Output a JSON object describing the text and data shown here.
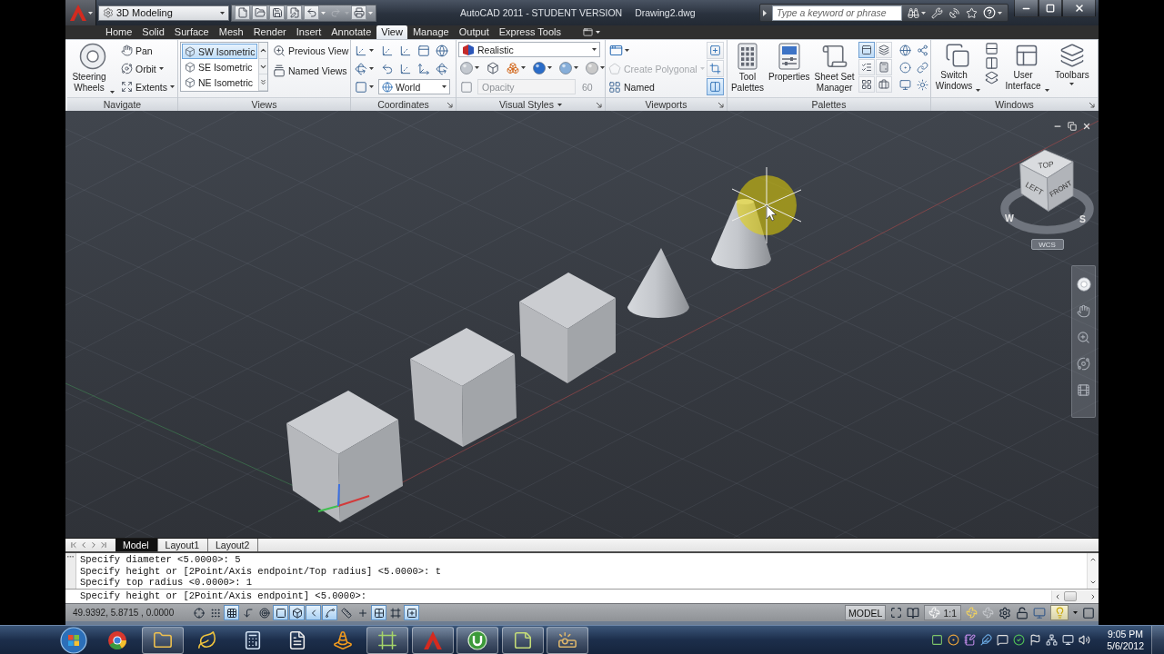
{
  "title_bar": {
    "workspace": "3D Modeling",
    "quick_access": [
      {
        "disabled": false
      },
      {
        "disabled": false
      },
      {
        "disabled": false
      },
      {
        "disabled": false
      },
      {
        "disabled": false
      },
      {
        "disabled": true
      },
      {
        "disabled": false
      }
    ],
    "app_title": "AutoCAD 2011 - STUDENT VERSION",
    "file_name": "Drawing2.dwg",
    "search": {
      "placeholder": "Type a keyword or phrase"
    }
  },
  "tabs": [
    {
      "label": "Home",
      "selected": false
    },
    {
      "label": "Solid",
      "selected": false
    },
    {
      "label": "Surface",
      "selected": false
    },
    {
      "label": "Mesh",
      "selected": false
    },
    {
      "label": "Render",
      "selected": false
    },
    {
      "label": "Insert",
      "selected": false
    },
    {
      "label": "Annotate",
      "selected": false
    },
    {
      "label": "View",
      "selected": true
    },
    {
      "label": "Manage",
      "selected": false
    },
    {
      "label": "Output",
      "selected": false
    },
    {
      "label": "Express Tools",
      "selected": false
    }
  ],
  "ribbon": {
    "navigate": {
      "title": "Navigate",
      "steering_wheels": "Steering Wheels",
      "tools": [
        "Pan",
        "Orbit",
        "Extents"
      ]
    },
    "views": {
      "title": "Views",
      "list": [
        {
          "label": "SW Isometric",
          "selected": true
        },
        {
          "label": "SE Isometric",
          "selected": false
        },
        {
          "label": "NE Isometric",
          "selected": false
        }
      ],
      "tools": [
        "Previous View",
        "Named Views"
      ]
    },
    "coordinates": {
      "title": "Coordinates",
      "ucs": "World"
    },
    "visual_styles": {
      "title": "Visual Styles",
      "style": "Realistic",
      "opacity": {
        "label": "Opacity",
        "value": "60",
        "disabled": true
      }
    },
    "viewports": {
      "title": "Viewports",
      "tools": [
        {
          "label": "Create Polygonal",
          "disabled": true
        },
        {
          "label": "Named",
          "disabled": false
        }
      ],
      "toggles": [
        {
          "on": false
        },
        {
          "on": false
        },
        {
          "on": true
        }
      ]
    },
    "palettes": {
      "title": "Palettes",
      "buttons": [
        "Tool Palettes",
        "Properties",
        "Sheet Set Manager"
      ],
      "toggles": [
        {
          "on": true
        },
        {
          "on": false
        },
        {
          "on": false
        },
        {
          "on": false
        },
        {
          "on": false
        },
        {
          "on": false
        }
      ]
    },
    "windows": {
      "title": "Windows",
      "buttons": [
        "Switch Windows",
        "User Interface",
        "Toolbars"
      ]
    }
  },
  "viewcube": {
    "faces": [
      "TOP",
      "LEFT",
      "FRONT"
    ],
    "compass": [
      "W",
      "S"
    ],
    "ucs_menu": "WCS"
  },
  "layout_tabs": [
    {
      "label": "Model",
      "selected": true
    },
    {
      "label": "Layout1",
      "selected": false
    },
    {
      "label": "Layout2",
      "selected": false
    }
  ],
  "command_line": {
    "history": [
      "Specify diameter <5.0000>: 5",
      "Specify height or [2Point/Axis endpoint/Top radius] <5.0000>: t",
      "Specify top radius <0.0000>: 1"
    ],
    "prompt": "Specify height or [2Point/Axis endpoint] <5.0000>:"
  },
  "status_bar": {
    "coordinates": "49.9392, 5.8715 , 0.0000",
    "toggles": [
      {
        "on": false
      },
      {
        "on": false
      },
      {
        "on": true
      },
      {
        "on": false
      },
      {
        "on": false
      },
      {
        "on": true
      },
      {
        "on": true
      },
      {
        "on": true
      },
      {
        "on": true
      },
      {
        "on": false
      },
      {
        "on": false
      },
      {
        "on": true
      },
      {
        "on": false
      },
      {
        "on": true
      }
    ],
    "space": "MODEL",
    "annotation_scale": "1:1"
  },
  "taskbar": {
    "apps": [
      {
        "running": false
      },
      {
        "running": true
      },
      {
        "running": false
      },
      {
        "running": false
      },
      {
        "running": false
      },
      {
        "running": false
      },
      {
        "running": true
      },
      {
        "running": true
      },
      {
        "running": true
      },
      {
        "running": true
      },
      {
        "running": true
      }
    ],
    "clock": {
      "time": "9:05 PM",
      "date": "5/6/2012"
    }
  }
}
